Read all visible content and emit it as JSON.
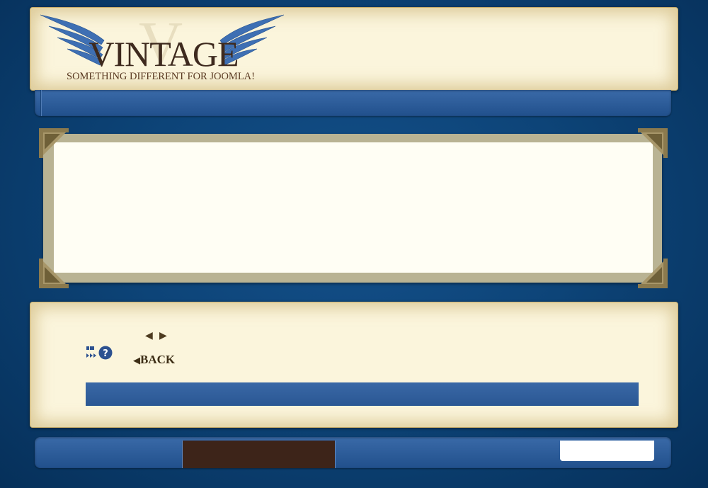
{
  "logo": {
    "title": "VINTAGE",
    "watermark_letter": "V",
    "tagline": "SOMETHING DIFFERENT FOR JOOMLA!"
  },
  "icons": {
    "prev": "◀",
    "next": "▶",
    "resize": "resize-icon",
    "help": "help-icon"
  },
  "controls": {
    "back_label": "BACK"
  },
  "footer": {
    "search_value": ""
  },
  "colors": {
    "background": "#0d4478",
    "parchment": "#fbf5dc",
    "nav_bar": "#2a5793",
    "footer_tab": "#3d2419",
    "logo_brown": "#3e2a1e",
    "logo_blue": "#3e6fb3"
  }
}
